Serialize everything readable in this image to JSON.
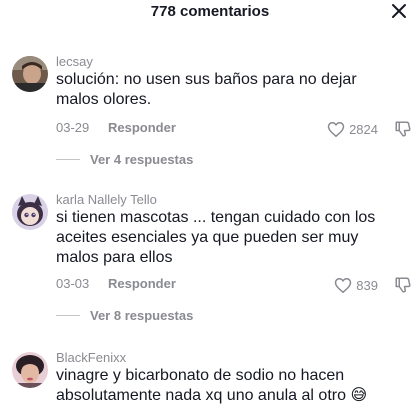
{
  "header": {
    "title": "778 comentarios"
  },
  "comments": [
    {
      "username": "lecsay",
      "text_lines": [
        "solución: no usen sus baños para no dejar",
        "malos olores."
      ],
      "date": "03-29",
      "reply_label": "Responder",
      "likes": "2824",
      "replies_label": "Ver 4 respuestas"
    },
    {
      "username": "karla Nallely Tello",
      "text_lines": [
        "si tienen mascotas ... tengan cuidado con los",
        "aceites esenciales ya que pueden ser muy",
        "malos para ellos"
      ],
      "date": "03-03",
      "reply_label": "Responder",
      "likes": "839",
      "replies_label": "Ver 8 respuestas"
    },
    {
      "username": "BlackFenixx",
      "text_lines": [
        "vinagre y bicarbonato de sodio no hacen",
        "absolutamente nada xq uno anula al otro 😅"
      ]
    }
  ],
  "icons": {
    "close": "close-icon",
    "like": "heart-outline-icon",
    "dislike": "thumbs-down-outline-icon"
  },
  "colors": {
    "text_primary": "#161823",
    "text_secondary": "#8a8b91"
  }
}
